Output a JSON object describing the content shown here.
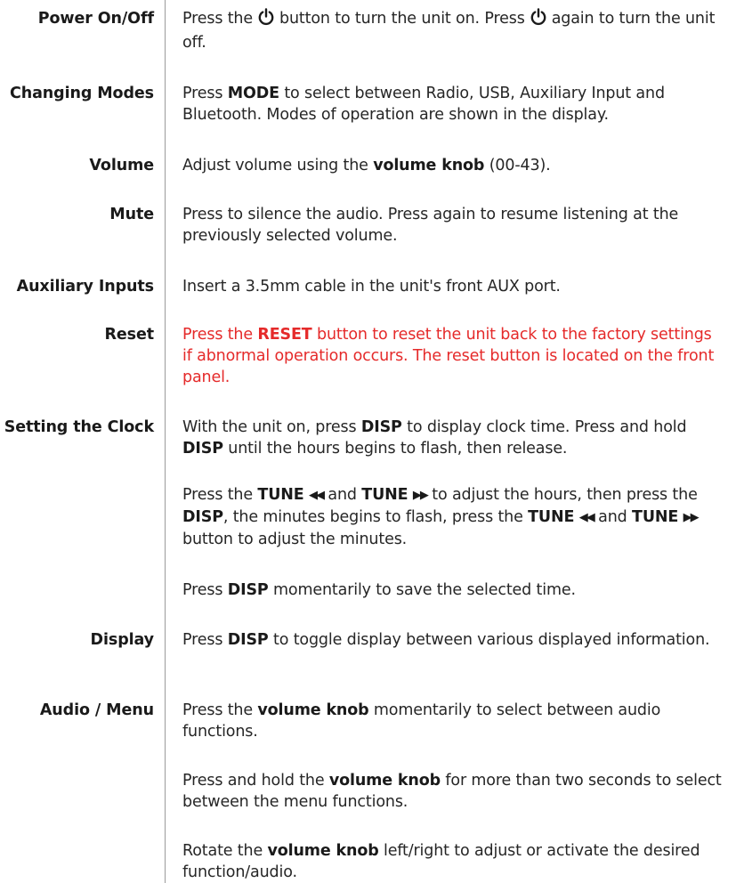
{
  "rows": {
    "power": {
      "label": "Power On/Off",
      "t1": "Press the",
      "t2": "button to turn the unit on. Press",
      "t3": "again to turn the unit off."
    },
    "modes": {
      "label": "Changing Modes",
      "t1": "Press ",
      "k1": "MODE",
      "t2": " to select between Radio, USB, Auxiliary Input and Bluetooth. Modes of operation are shown in the display."
    },
    "volume": {
      "label": "Volume",
      "t1": "Adjust volume using the ",
      "k1": "volume knob",
      "t2": " (00-43)."
    },
    "mute": {
      "label": "Mute",
      "t1": "Press to silence the audio. Press again to resume listening at the previously selected volume."
    },
    "aux": {
      "label": "Auxiliary Inputs",
      "t1": "Insert a 3.5mm cable in the unit's front AUX port."
    },
    "reset": {
      "label": "Reset",
      "t1": "Press the ",
      "k1": "RESET",
      "t2": " button to reset the unit back to the factory settings if abnormal operation occurs. The reset button is located on the front panel."
    },
    "clock": {
      "label": "Setting the Clock",
      "p1_t1": "With the unit on, press ",
      "p1_k1": "DISP",
      "p1_t2": " to display clock time. Press and hold ",
      "p1_k2": "DISP",
      "p1_t3": " until the hours begins to flash, then release.",
      "p2_t1": "Press the ",
      "p2_k1": "TUNE",
      "p2_tri_prev": "◀◀",
      "p2_t2": " and ",
      "p2_k2": "TUNE",
      "p2_tri_next": "▶▶",
      "p2_t3": " to adjust the hours, then press the ",
      "p2_k3": "DISP",
      "p2_t4": ", the minutes begins to flash, press the ",
      "p2_k4": "TUNE",
      "p2_tri_prev2": "◀◀",
      "p2_t5": " and ",
      "p2_k5": "TUNE",
      "p2_tri_next2": "▶▶",
      "p2_t6": " button to adjust the minutes.",
      "p3_t1": "Press ",
      "p3_k1": "DISP",
      "p3_t2": " momentarily to save the selected time."
    },
    "display": {
      "label": "Display",
      "t1": "Press ",
      "k1": "DISP",
      "t2": " to toggle display between various displayed information."
    },
    "audio": {
      "label": "Audio / Menu",
      "p1_t1": "Press the ",
      "p1_k1": "volume knob",
      "p1_t2": " momentarily to select between audio functions.",
      "p2_t1": "Press and hold the ",
      "p2_k1": "volume knob",
      "p2_t2": " for more than two seconds to select between the menu functions.",
      "p3_t1": "Rotate the ",
      "p3_k1": "volume knob",
      "p3_t2": " left/right to adjust or activate the desired function/audio."
    }
  },
  "colors": {
    "text": "#262626",
    "label": "#1a1a1a",
    "warning": "#e52a2a",
    "divider": "#9a9a9a"
  },
  "icons": {
    "power": "power-icon"
  }
}
